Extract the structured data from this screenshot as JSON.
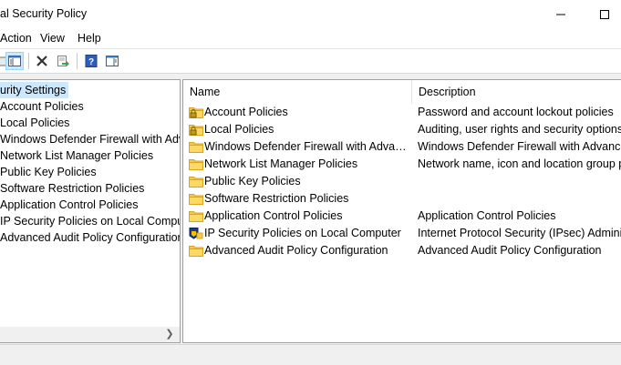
{
  "window": {
    "title": "al Security Policy"
  },
  "menu": {
    "action": "Action",
    "view": "View",
    "help": "Help"
  },
  "toolbar": {
    "buttons": [
      {
        "icon": "up-one-level-icon"
      },
      {
        "icon": "show-hide-tree-icon"
      },
      {
        "icon": "delete-icon"
      },
      {
        "icon": "export-list-icon"
      },
      {
        "icon": "help-icon"
      },
      {
        "icon": "properties-icon"
      }
    ]
  },
  "tree": {
    "items": [
      {
        "label": "urity Settings",
        "selected": true
      },
      {
        "label": "Account Policies"
      },
      {
        "label": "Local Policies"
      },
      {
        "label": "Windows Defender Firewall with Adva"
      },
      {
        "label": "Network List Manager Policies"
      },
      {
        "label": "Public Key Policies"
      },
      {
        "label": "Software Restriction Policies"
      },
      {
        "label": "Application Control Policies"
      },
      {
        "label": "IP Security Policies on Local Compute"
      },
      {
        "label": "Advanced Audit Policy Configuration"
      }
    ]
  },
  "list": {
    "headers": {
      "name": "Name",
      "description": "Description"
    },
    "rows": [
      {
        "name": "Account Policies",
        "description": "Password and account lockout policies",
        "icon": "locked-folder"
      },
      {
        "name": "Local Policies",
        "description": "Auditing, user rights and security options p",
        "icon": "locked-folder"
      },
      {
        "name": "Windows Defender Firewall with Advanc...",
        "description": "Windows Defender Firewall with Advanced",
        "icon": "folder"
      },
      {
        "name": "Network List Manager Policies",
        "description": "Network name, icon and location group po",
        "icon": "folder"
      },
      {
        "name": "Public Key Policies",
        "description": "",
        "icon": "folder"
      },
      {
        "name": "Software Restriction Policies",
        "description": "",
        "icon": "folder"
      },
      {
        "name": "Application Control Policies",
        "description": "Application Control Policies",
        "icon": "folder"
      },
      {
        "name": "IP Security Policies on Local Computer",
        "description": "Internet Protocol Security (IPsec) Administ",
        "icon": "ipsec-policy"
      },
      {
        "name": "Advanced Audit Policy Configuration",
        "description": "Advanced Audit Policy Configuration",
        "icon": "folder"
      }
    ]
  },
  "colors": {
    "selection": "#cce8ff",
    "folder": "#f5c94a",
    "folder_dark": "#d9a520"
  }
}
